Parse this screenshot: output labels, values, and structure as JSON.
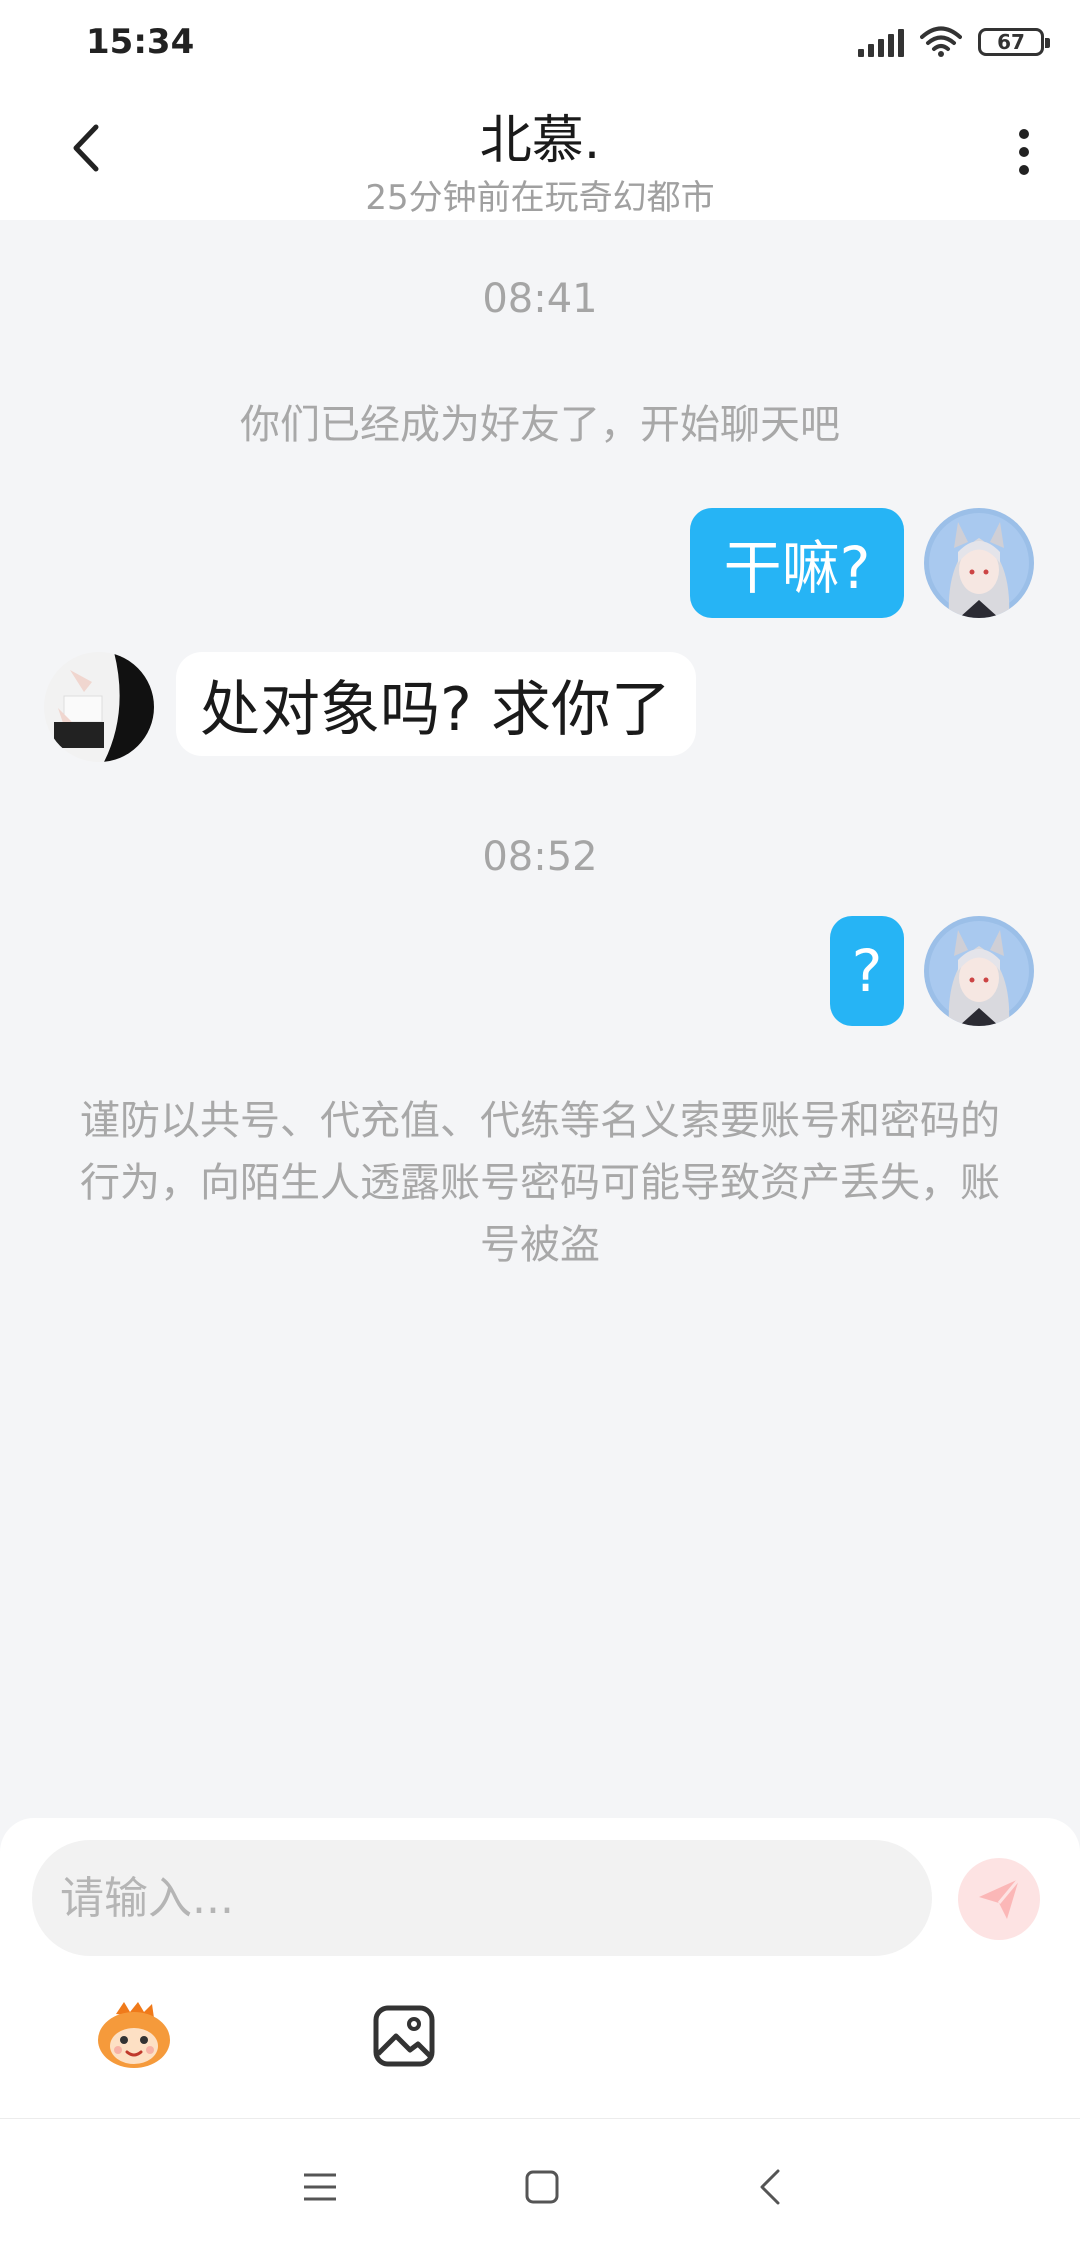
{
  "status_bar": {
    "time": "15:34",
    "battery": "67",
    "icons": [
      "signal-icon",
      "wifi-icon",
      "battery-icon"
    ]
  },
  "header": {
    "title": "北慕.",
    "subtitle": "25分钟前在玩奇幻都市",
    "back_icon": "chevron-left-icon",
    "menu_icon": "more-vertical-icon"
  },
  "chat": {
    "timestamp_1": "08:41",
    "system_note": "你们已经成为好友了，开始聊天吧",
    "messages": [
      {
        "sender": "me",
        "text": "干嘛?"
      },
      {
        "sender": "friend",
        "text": "处对象吗? 求你了"
      },
      {
        "sender": "me",
        "text": "?"
      }
    ],
    "timestamp_2": "08:52",
    "warning": "谨防以共号、代充值、代练等名义索要账号和密码的行为，向陌生人透露账号密码可能导致资产丢失，账号被盗"
  },
  "input": {
    "placeholder": "请输入...",
    "value": ""
  },
  "toolbar": {
    "emoji_icon": "emoji-mascot-icon",
    "image_icon": "image-icon",
    "send_icon": "send-icon"
  },
  "colors": {
    "outgoing_bubble": "#26b4f5",
    "incoming_bubble": "#ffffff",
    "background": "#f4f5f7",
    "send_button": "#fde3e3"
  }
}
